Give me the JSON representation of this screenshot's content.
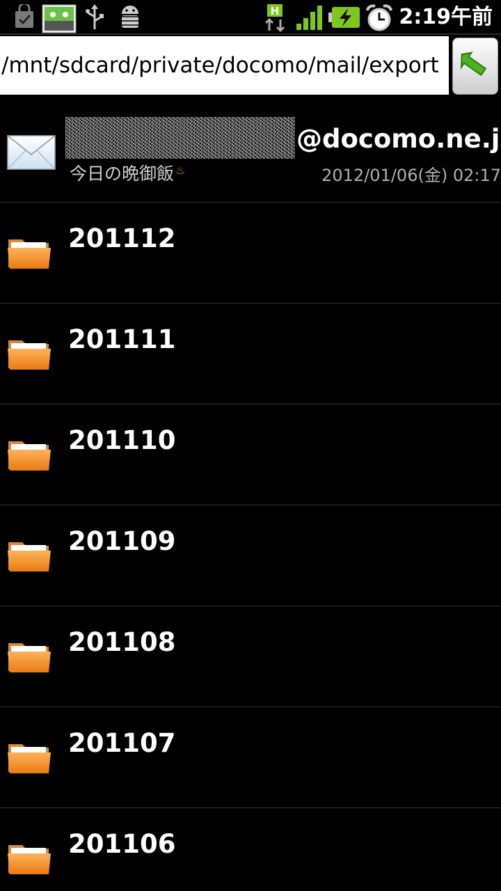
{
  "status_bar": {
    "time": "2:19午前",
    "icons": [
      "task-check-icon",
      "notification-app-icon",
      "usb-icon",
      "android-debug-icon",
      "hsdpa-data-icon",
      "signal-icon",
      "battery-charging-icon",
      "alarm-icon"
    ],
    "accent_green": "#7ec81e"
  },
  "path_bar": {
    "path": "/mnt/sdcard/private/docomo/mail/export",
    "go_icon": "go-arrow-icon"
  },
  "mail_item": {
    "sender_domain": "@docomo.ne.jp",
    "subject": "今日の晩御飯",
    "date": "2012/01/06(金) 02:17"
  },
  "folders": [
    {
      "name": "201112"
    },
    {
      "name": "201111"
    },
    {
      "name": "201110"
    },
    {
      "name": "201109"
    },
    {
      "name": "201108"
    },
    {
      "name": "201107"
    },
    {
      "name": "201106"
    }
  ],
  "colors": {
    "folder": "#f08a1c",
    "background": "#000000"
  }
}
